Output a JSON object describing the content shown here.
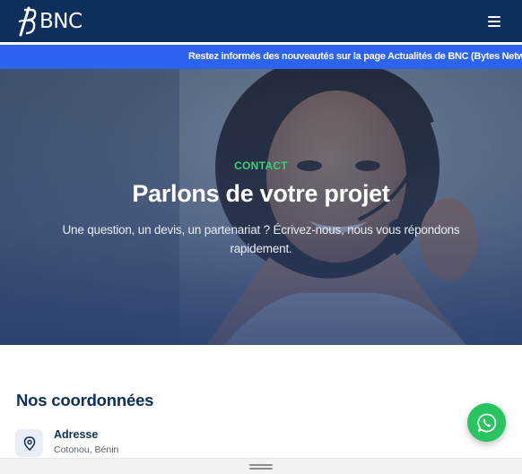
{
  "header": {
    "logo_text": "BNC",
    "menu_icon": "hamburger-icon"
  },
  "ticker": {
    "text": "Restez informés des nouveautés sur la page Actualités de BNC (Bytes Networking Consulting)"
  },
  "hero": {
    "eyebrow": "CONTACT",
    "title": "Parlons de votre projet",
    "subtitle": "Une question, un devis, un partenariat ? Écrivez-nous, nous vous répondons rapidement."
  },
  "contact": {
    "section_title": "Nos coordonnées",
    "address_icon": "location-pin-icon",
    "address_label": "Adresse",
    "address_value": "Cotonou, Bénin"
  },
  "floating": {
    "whatsapp_icon": "whatsapp-icon"
  },
  "colors": {
    "navbar": "#0e2f5b",
    "ticker": "#2c63f0",
    "accent_green": "#3ad07a",
    "whatsapp": "#27c45f",
    "heading": "#0e2f5b"
  }
}
